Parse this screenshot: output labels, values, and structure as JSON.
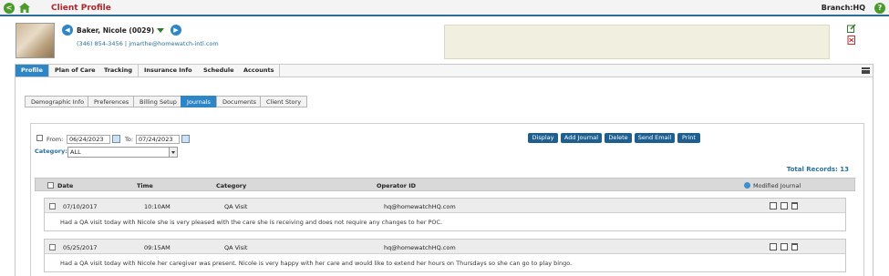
{
  "header": {
    "title": "Client Profile",
    "branch": "Branch:HQ",
    "back_glyph": "<",
    "help_glyph": "?",
    "icons": [
      "back-icon",
      "home-icon",
      "help-icon"
    ]
  },
  "client": {
    "name": "Baker, Nicole (0029)",
    "phone": "(346) 854-3456",
    "separator": "|",
    "email": "jmarthe@homewatch-intl.com",
    "prev_glyph": "◀",
    "next_glyph": "▶"
  },
  "main_tabs": [
    {
      "label": "Profile",
      "active": true
    },
    {
      "label": "Plan of Care",
      "active": false
    },
    {
      "label": "Tracking",
      "active": false
    },
    {
      "label": "Insurance Info",
      "active": false
    },
    {
      "label": "Schedule",
      "active": false
    },
    {
      "label": "Accounts",
      "active": false
    }
  ],
  "sub_tabs": [
    {
      "label": "Demographic Info",
      "active": false
    },
    {
      "label": "Preferences",
      "active": false
    },
    {
      "label": "Billing Setup",
      "active": false
    },
    {
      "label": "Journals",
      "active": true
    },
    {
      "label": "Documents",
      "active": false
    },
    {
      "label": "Client Story",
      "active": false
    }
  ],
  "filters": {
    "from_label": "From:",
    "from_value": "06/24/2023",
    "to_label": "To:",
    "to_value": "07/24/2023",
    "category_label": "Category:",
    "category_value": "ALL"
  },
  "actions": {
    "display": "Display",
    "add_journal": "Add Journal",
    "delete": "Delete",
    "send_email": "Send Email",
    "print": "Print"
  },
  "total_records": "Total Records: 13",
  "table": {
    "columns": [
      "Date",
      "Time",
      "Category",
      "Operator ID"
    ],
    "modified_label": "Modified Journal",
    "rows": [
      {
        "date": "07/10/2017",
        "time": "10:10AM",
        "category": "QA Visit",
        "operator": "hq@homewatchHQ.com",
        "note": "Had a QA visit today with Nicole she is very pleased with the care she is receiving and does not require any changes to her POC."
      },
      {
        "date": "05/25/2017",
        "time": "09:15AM",
        "category": "QA Visit",
        "operator": "hq@homewatchHQ.com",
        "note": "Had a QA visit today with Nicole her caregiver was present. Nicole is very happy with her care and would like to extend her hours on Thursdays so she can go to play bingo."
      }
    ]
  },
  "colors": {
    "accent": "#2f86c6",
    "title_red": "#b0262b",
    "action_button": "#1f5f8f",
    "green": "#4a9a2c"
  }
}
